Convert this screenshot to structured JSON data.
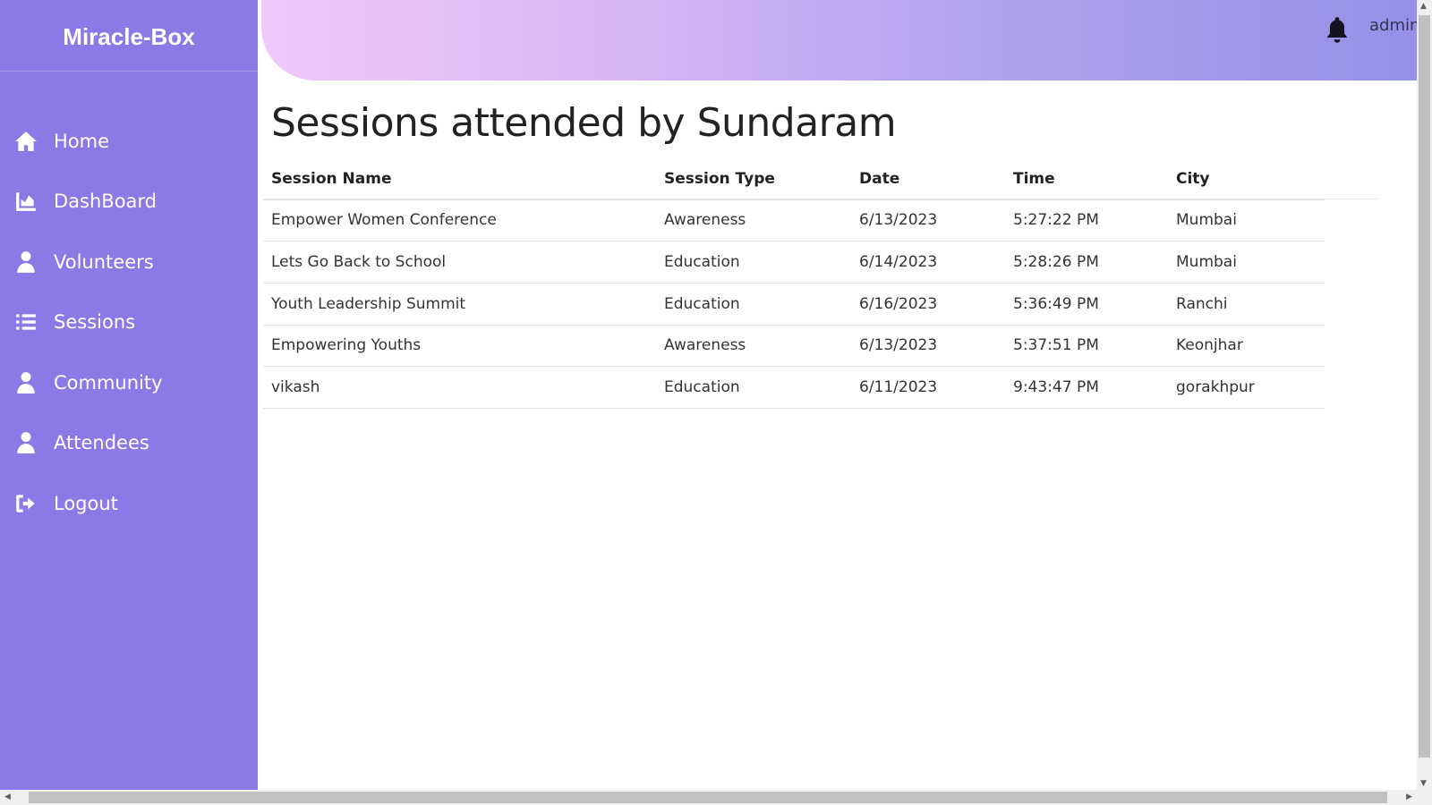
{
  "app": {
    "brand": "Miracle-Box"
  },
  "sidebar": {
    "items": [
      {
        "label": "Home",
        "icon": "home-icon"
      },
      {
        "label": "DashBoard",
        "icon": "chart-area-icon"
      },
      {
        "label": "Volunteers",
        "icon": "user-doctor-icon"
      },
      {
        "label": "Sessions",
        "icon": "list-icon"
      },
      {
        "label": "Community",
        "icon": "user-icon"
      },
      {
        "label": "Attendees",
        "icon": "user-icon"
      },
      {
        "label": "Logout",
        "icon": "sign-out-icon"
      }
    ]
  },
  "header": {
    "user": "admin",
    "notification_icon": "bell-icon",
    "gradient": [
      "#f0c9fb",
      "#9590e8"
    ]
  },
  "main": {
    "title": "Sessions attended by Sundaram",
    "columns": [
      "Session Name",
      "Session Type",
      "Date",
      "Time",
      "City"
    ],
    "rows": [
      [
        "Empower Women Conference",
        "Awareness",
        "6/13/2023",
        "5:27:22 PM",
        "Mumbai"
      ],
      [
        "Lets Go Back to School",
        "Education",
        "6/14/2023",
        "5:28:26 PM",
        "Mumbai"
      ],
      [
        "Youth Leadership Summit",
        "Education",
        "6/16/2023",
        "5:36:49 PM",
        "Ranchi"
      ],
      [
        "Empowering Youths",
        "Awareness",
        "6/13/2023",
        "5:37:51 PM",
        "Keonjhar"
      ],
      [
        "vikash",
        "Education",
        "6/11/2023",
        "9:43:47 PM",
        "gorakhpur"
      ]
    ]
  },
  "colors": {
    "sidebar": "#8b7ae6"
  }
}
